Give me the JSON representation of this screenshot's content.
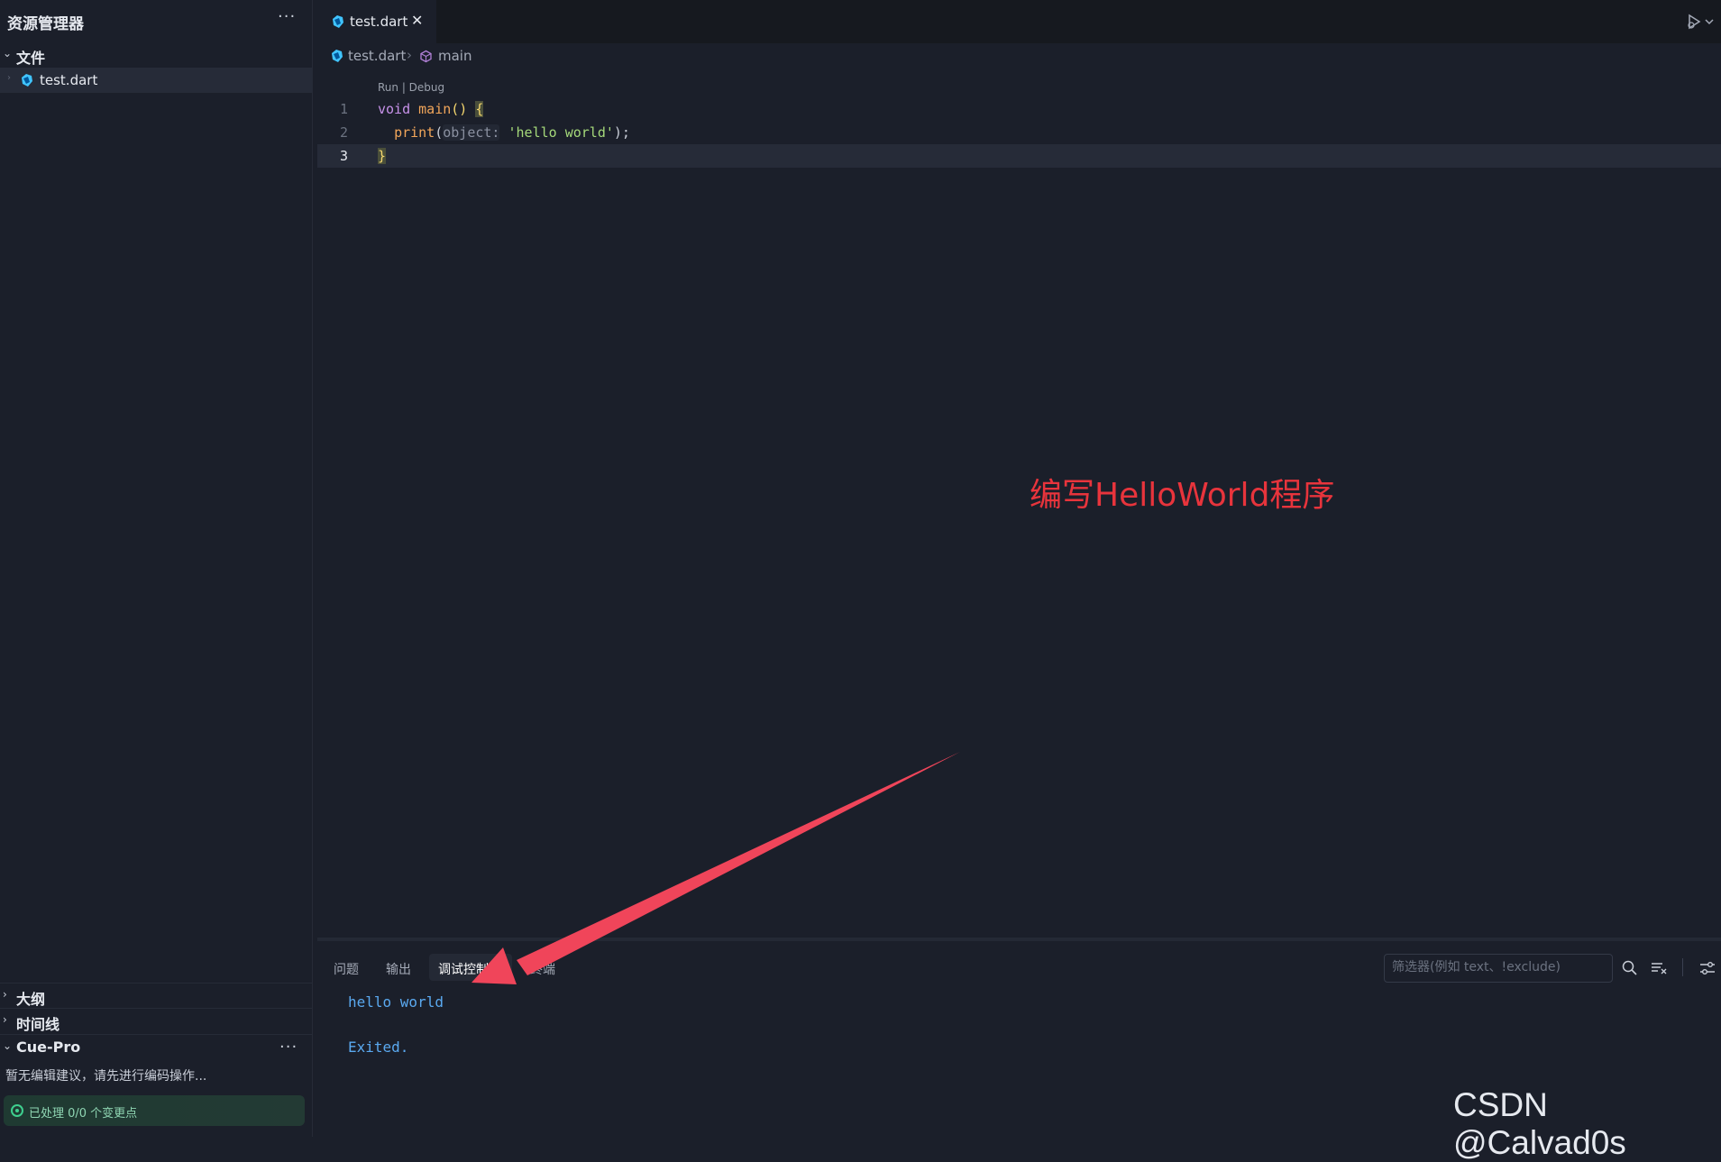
{
  "sidebar": {
    "title": "资源管理器",
    "more_label": "···",
    "sections": {
      "files": "文件",
      "outline": "大纲",
      "timeline": "时间线",
      "cue": "Cue-Pro"
    },
    "file_name": "test.dart",
    "cue_message": "暂无编辑建议，请先进行编码操作...",
    "cue_status": "已处理 0/0 个变更点"
  },
  "tabs": [
    {
      "label": "test.dart",
      "active": true,
      "close": "✕"
    }
  ],
  "breadcrumb": {
    "file": "test.dart",
    "separator": "›",
    "symbol": "main"
  },
  "editor": {
    "codelens": "Run | Debug",
    "line_numbers": [
      "1",
      "2",
      "3"
    ],
    "code": {
      "line1": {
        "kw": "void",
        "fn": "main",
        "parens": "()",
        "brace": "{"
      },
      "line2": {
        "fn": "print",
        "open": "(",
        "hint": "object:",
        "str": "'hello world'",
        "close": ");"
      },
      "line3": {
        "brace": "}"
      }
    },
    "annotation": "编写HelloWorld程序"
  },
  "panel": {
    "tabs": {
      "problems": "问题",
      "output": "输出",
      "debug_console": "调试控制台",
      "terminal": "终端"
    },
    "filter_placeholder": "筛选器(例如 text、!exclude)",
    "output_lines": [
      "hello world",
      "Exited."
    ]
  },
  "watermark": "CSDN @Calvad0s",
  "colors": {
    "background": "#1b1f2a",
    "annotation": "#e8343c",
    "arrow": "#f0455a",
    "console_output": "#5aa9f0",
    "dart_blue": "#40c4ff"
  }
}
